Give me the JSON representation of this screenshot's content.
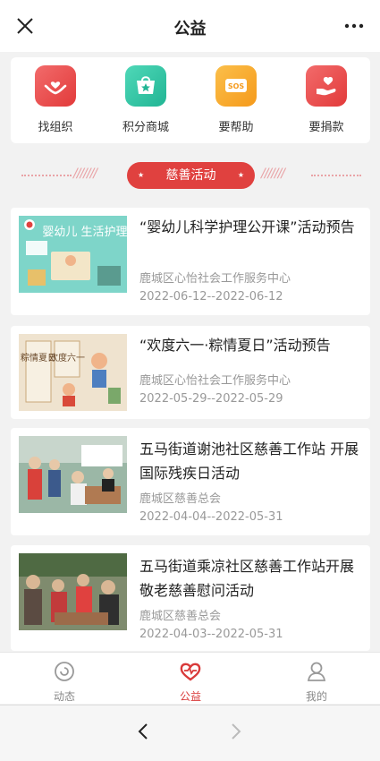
{
  "header": {
    "title": "公益"
  },
  "shortcuts": [
    {
      "label": "找组织",
      "color": "#ec4a4a",
      "icon": "hands-heart-icon"
    },
    {
      "label": "积分商城",
      "color": "#2ec4a5",
      "icon": "star-shop-icon"
    },
    {
      "label": "要帮助",
      "color": "#f5a623",
      "icon": "sos-icon"
    },
    {
      "label": "要捐款",
      "color": "#ec4a4a",
      "icon": "donate-heart-icon"
    }
  ],
  "section": {
    "title": "慈善活动",
    "slashes": "///////"
  },
  "activities": [
    {
      "title": "“婴幼儿科学护理公开课”活动预告",
      "org": "鹿城区心怡社会工作服务中心",
      "date": "2022-06-12--2022-06-12",
      "thumb_text": "婴幼儿 生活护理"
    },
    {
      "title": "“欢度六一·粽情夏日”活动预告",
      "org": "鹿城区心怡社会工作服务中心",
      "date": "2022-05-29--2022-05-29",
      "thumb_text_a": "粽情夏日",
      "thumb_text_b": "欢度六一"
    },
    {
      "title": "五马街道谢池社区慈善工作站 开展国际残疾日活动",
      "org": "鹿城区慈善总会",
      "date": "2022-04-04--2022-05-31"
    },
    {
      "title": "五马街道乘凉社区慈善工作站开展 敬老慈善慰问活动",
      "org": "鹿城区慈善总会",
      "date": "2022-04-03--2022-05-31"
    }
  ],
  "tabs": [
    {
      "label": "动态"
    },
    {
      "label": "公益"
    },
    {
      "label": "我的"
    }
  ],
  "colors": {
    "accent": "#e0413f",
    "tab_active": "#d93a3a"
  }
}
